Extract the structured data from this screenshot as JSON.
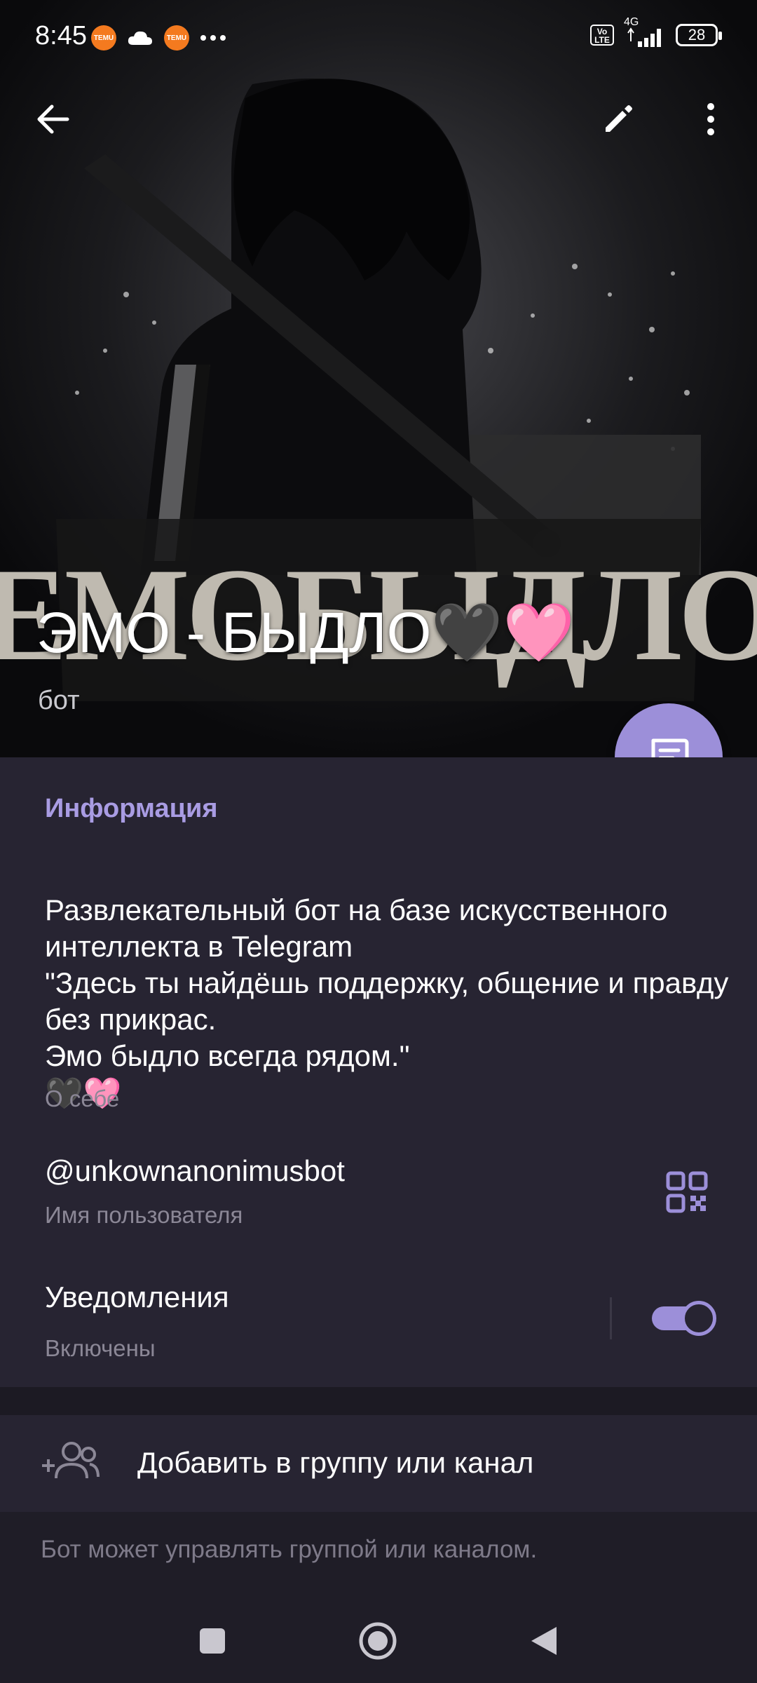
{
  "status_bar": {
    "time": "8:45",
    "left_icons": [
      "temu-icon",
      "cloud-icon",
      "temu-icon",
      "more-dots-icon"
    ],
    "temu_label": "TEMU",
    "volte_label": "Vo LTE",
    "network_label": "4G",
    "battery_level": "28"
  },
  "toolbar": {
    "back_icon": "back-arrow-icon",
    "edit_icon": "pencil-icon",
    "menu_icon": "more-vert-icon"
  },
  "profile": {
    "name": "ЭМО - БЫДЛО🖤🩷",
    "type": "бот",
    "banner_logo_text": "ЕМОБЫДЛО"
  },
  "fab": {
    "icon": "message-icon"
  },
  "info": {
    "section_title": "Информация",
    "about_text": "Развлекательный бот на базе искусственного интеллекта в Telegram\n\"Здесь ты найдёшь поддержку, общение и правду без прикрас.\nЭмо быдло всегда рядом.\"",
    "about_emoji": "🖤🩷",
    "about_caption": "О себе",
    "username": "@unkownanonimusbot",
    "username_caption": "Имя пользователя",
    "notifications_label": "Уведомления",
    "notifications_state": "Включены",
    "notifications_on": true
  },
  "actions": {
    "add_to_group_label": "Добавить в группу или канал",
    "add_icon": "add-users-icon"
  },
  "footer_note": "Бот может управлять группой или каналом.",
  "colors": {
    "accent": "#9c8fd9",
    "section_title": "#a99ce3",
    "panel_bg": "#272432",
    "page_bg": "#1f1d27",
    "pink_heart": "#ff4fb3",
    "black_heart": "#2a2a2a"
  }
}
